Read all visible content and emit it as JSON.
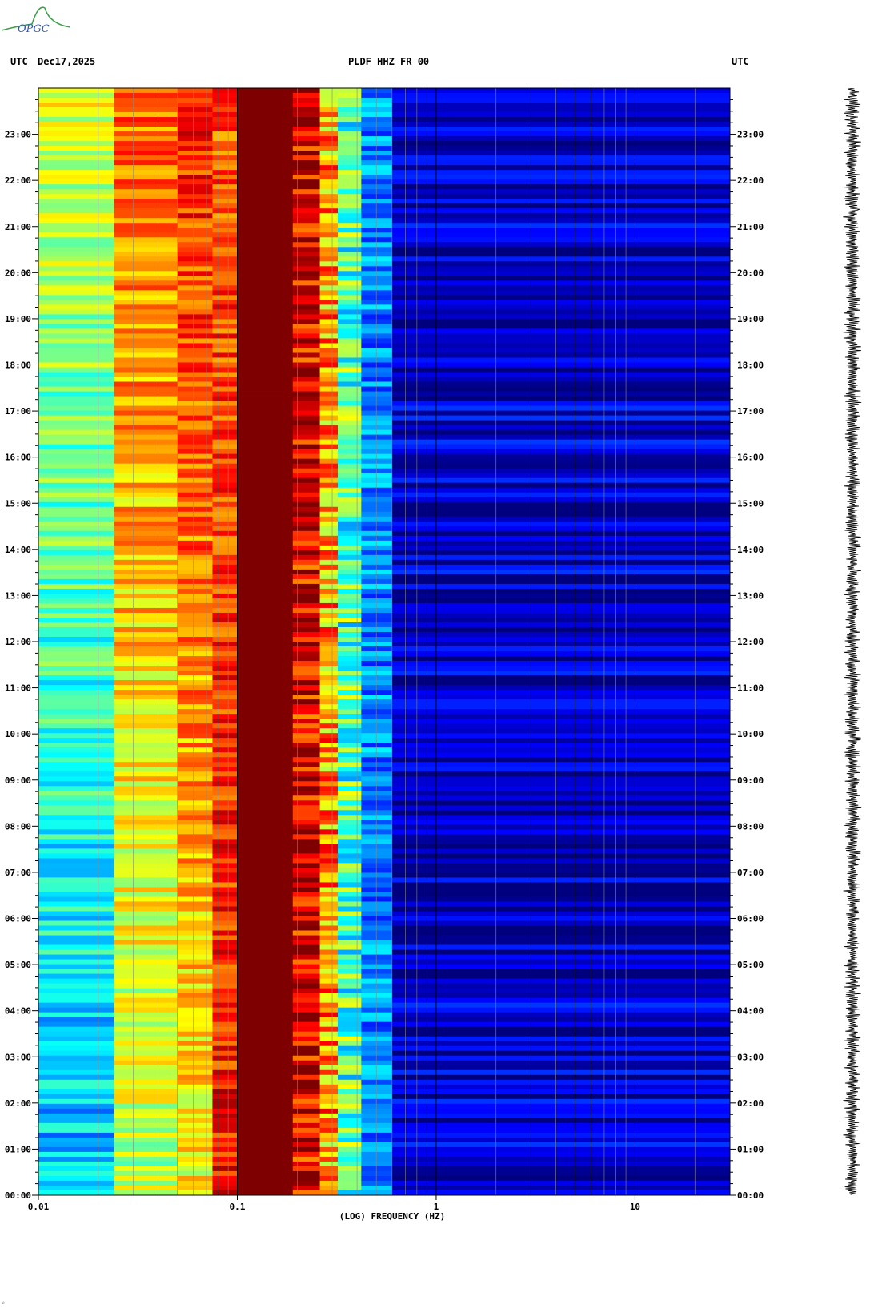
{
  "header": {
    "left_tz": "UTC",
    "date": "Dec17,2025",
    "station": "PLDF HHZ FR 00",
    "right_tz": "UTC"
  },
  "logo": {
    "text": "OPGC",
    "color": "#3aa04a"
  },
  "chart_data": {
    "type": "heatmap",
    "title": "PLDF HHZ FR 00",
    "xlabel": "(LOG) FREQUENCY (HZ)",
    "ylabel": "",
    "x_scale": "log",
    "xlim": [
      0.01,
      30
    ],
    "x_ticks": [
      {
        "value": 0.01,
        "label": "0.01"
      },
      {
        "value": 0.1,
        "label": "0.1"
      },
      {
        "value": 1,
        "label": "1"
      },
      {
        "value": 10,
        "label": "10"
      }
    ],
    "ylim_hours": [
      0,
      24
    ],
    "y_ticks": [
      "00:00",
      "01:00",
      "02:00",
      "03:00",
      "04:00",
      "05:00",
      "06:00",
      "07:00",
      "08:00",
      "09:00",
      "10:00",
      "11:00",
      "12:00",
      "13:00",
      "14:00",
      "15:00",
      "16:00",
      "17:00",
      "18:00",
      "19:00",
      "20:00",
      "21:00",
      "22:00",
      "23:00"
    ],
    "frequency_bands": [
      {
        "f_min": 0.01,
        "f_max": 0.024,
        "level_start": 0.3,
        "level_end": 0.58
      },
      {
        "f_min": 0.024,
        "f_max": 0.05,
        "level_start": 0.55,
        "level_end": 0.78
      },
      {
        "f_min": 0.05,
        "f_max": 0.075,
        "level_start": 0.62,
        "level_end": 0.86
      },
      {
        "f_min": 0.075,
        "f_max": 0.1,
        "level_start": 0.86,
        "level_end": 0.8
      },
      {
        "f_min": 0.1,
        "f_max": 0.19,
        "level_start": 1.0,
        "level_end": 1.0
      },
      {
        "f_min": 0.19,
        "f_max": 0.26,
        "level_start": 0.9,
        "level_end": 0.92
      },
      {
        "f_min": 0.26,
        "f_max": 0.32,
        "level_start": 0.72,
        "level_end": 0.72
      },
      {
        "f_min": 0.32,
        "f_max": 0.42,
        "level_start": 0.45,
        "level_end": 0.45
      },
      {
        "f_min": 0.42,
        "f_max": 0.6,
        "level_start": 0.26,
        "level_end": 0.26
      },
      {
        "f_min": 0.6,
        "f_max": 30,
        "level_start": 0.07,
        "level_end": 0.07
      }
    ],
    "colormap": [
      "#00007f",
      "#0000ff",
      "#0080ff",
      "#00ffff",
      "#80ff80",
      "#ffff00",
      "#ff8000",
      "#ff0000",
      "#7f0000"
    ]
  },
  "trace_color": "#000000",
  "corner_mark": "☆"
}
